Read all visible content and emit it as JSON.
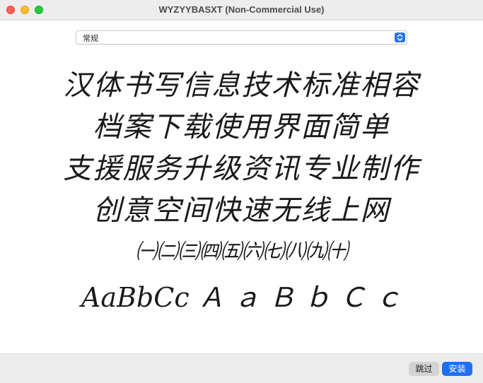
{
  "window": {
    "title": "WYZYYBASXT (Non-Commercial Use)"
  },
  "style_select": {
    "value": "常规"
  },
  "preview": {
    "lines": [
      "汉体书写信息技术标准相容",
      "档案下载使用界面简单",
      "支援服务升级资讯专业制作",
      "创意空间快速无线上网",
      "㈠㈡㈢㈣㈤㈥㈦㈧㈨㈩",
      "AaBbCc Ａ ａ Ｂ ｂ Ｃ ｃ"
    ]
  },
  "footer": {
    "skip_label": "跳过",
    "install_label": "安装"
  },
  "colors": {
    "accent": "#1f6ff2",
    "close": "#fe5f57",
    "minimize": "#febc2e",
    "zoom": "#28c840"
  }
}
